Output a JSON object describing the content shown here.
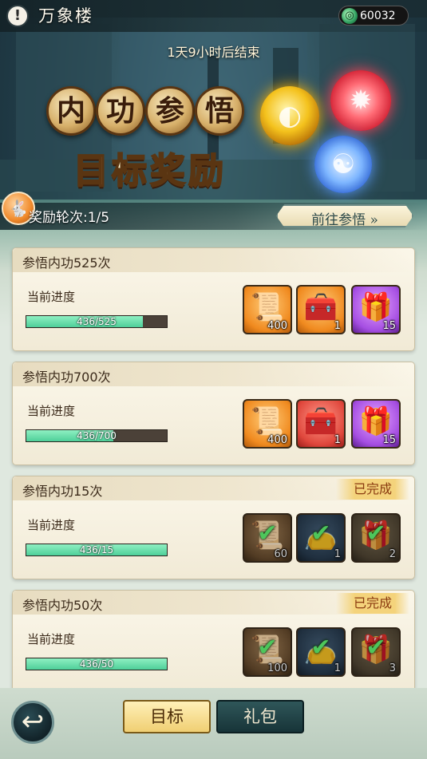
{
  "header": {
    "info_icon": "info-icon",
    "title": "万象楼",
    "currency": {
      "icon": "jade-coin-icon",
      "value": "60032"
    }
  },
  "timer_text": "1天9小时后结束",
  "banner": {
    "title_chars": [
      "内",
      "功",
      "参",
      "悟"
    ],
    "subtitle": "目标奖励",
    "orbs": [
      "gold-orb-icon",
      "red-orb-icon",
      "taiji-orb-icon"
    ]
  },
  "round": {
    "badge_icon": "rabbit-mascot-icon",
    "text": "奖励轮次:1/5",
    "goto_label": "前往参悟 »"
  },
  "progress_label": "当前进度",
  "done_label": "已完成",
  "tasks": [
    {
      "title": "参悟内功525次",
      "progress_text": "436/525",
      "progress_fraction": 0.83,
      "completed": false,
      "rewards": [
        {
          "icon": "scroll-icon",
          "rarity": "orange",
          "count": "400"
        },
        {
          "icon": "treasure-chest-icon",
          "rarity": "orange",
          "count": "1"
        },
        {
          "icon": "jade-chest-icon",
          "rarity": "purple",
          "count": "15"
        }
      ]
    },
    {
      "title": "参悟内功700次",
      "progress_text": "436/700",
      "progress_fraction": 0.62,
      "completed": false,
      "rewards": [
        {
          "icon": "scroll-icon",
          "rarity": "orange",
          "count": "400"
        },
        {
          "icon": "treasure-chest-icon",
          "rarity": "red",
          "count": "1"
        },
        {
          "icon": "jade-chest-icon",
          "rarity": "purple",
          "count": "15"
        }
      ]
    },
    {
      "title": "参悟内功15次",
      "progress_text": "436/15",
      "progress_fraction": 1.0,
      "completed": true,
      "rewards": [
        {
          "icon": "scroll-icon",
          "rarity": "brown",
          "count": "60"
        },
        {
          "icon": "pouch-icon",
          "rarity": "navy",
          "count": "1"
        },
        {
          "icon": "jade-chest-icon",
          "rarity": "olive",
          "count": "2"
        }
      ]
    },
    {
      "title": "参悟内功50次",
      "progress_text": "436/50",
      "progress_fraction": 1.0,
      "completed": true,
      "rewards": [
        {
          "icon": "scroll-icon",
          "rarity": "brown",
          "count": "100"
        },
        {
          "icon": "pouch-icon",
          "rarity": "navy",
          "count": "1"
        },
        {
          "icon": "jade-chest-icon",
          "rarity": "olive",
          "count": "3"
        }
      ]
    }
  ],
  "bottom": {
    "back_icon": "back-arrow-icon",
    "tabs": [
      {
        "label": "目标",
        "active": true
      },
      {
        "label": "礼包",
        "active": false
      }
    ]
  }
}
